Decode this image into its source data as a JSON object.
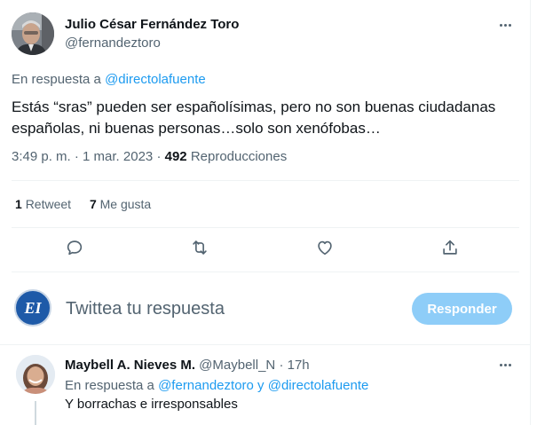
{
  "main_tweet": {
    "author_name": "Julio César Fernández Toro",
    "author_handle": "@fernandeztoro",
    "reply_prefix": "En respuesta a",
    "reply_to": "@directolafuente",
    "text": "Estás “sras” pueden ser españolísimas, pero no son buenas ciudadanas españolas, ni buenas personas…solo son xenófobas…",
    "time": "3:49 p. m.",
    "separator": "·",
    "date": "1 mar. 2023",
    "views_count": "492",
    "views_label": "Reproducciones"
  },
  "stats": {
    "retweets_count": "1",
    "retweets_label": "Retweet",
    "likes_count": "7",
    "likes_label": "Me gusta"
  },
  "actions": [
    "reply-icon",
    "retweet-icon",
    "like-icon",
    "share-icon"
  ],
  "composer": {
    "avatar_text": "EI",
    "placeholder": "Twittea tu respuesta",
    "button_label": "Responder"
  },
  "reply_tweet": {
    "author_name": "Maybell A. Nieves M.",
    "author_handle": "@Maybell_N",
    "separator": "·",
    "age": "17h",
    "reply_prefix": "En respuesta a",
    "reply_to_1": "@fernandeztoro",
    "conjunction": "y",
    "reply_to_2": "@directolafuente",
    "text": "Y borrachas e irresponsables"
  },
  "colors": {
    "accent": "#1d9bf0",
    "button_disabled": "#8ecdf8",
    "muted_text": "#536471",
    "border": "#eff3f4",
    "logo_blue": "#1e5aa8"
  }
}
